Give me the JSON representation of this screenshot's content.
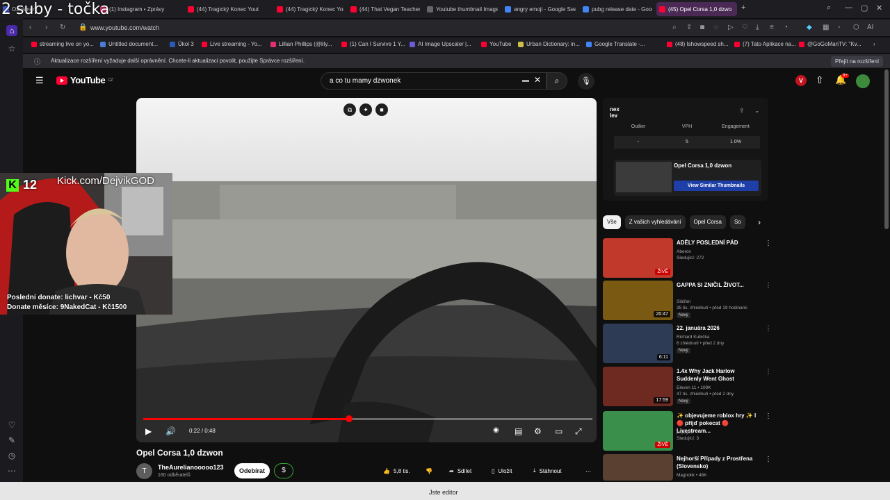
{
  "overlay_title": "2 suby - točka",
  "browser": {
    "tabs": [
      {
        "label": "Oznámení",
        "color": "#3b5bdb"
      },
      {
        "label": "(1) Instagram • Zprávy",
        "color": "#e1306c"
      },
      {
        "label": "(44) Tragický Konec Yout",
        "color": "#ff0033"
      },
      {
        "label": "(44) Tragický Konec Yout",
        "color": "#ff0033"
      },
      {
        "label": "(44) That Vegan Teacher I",
        "color": "#ff0033"
      },
      {
        "label": "Youtube thumbnail Image",
        "color": "#666666"
      },
      {
        "label": "angry emoji - Google Sea",
        "color": "#4285f4"
      },
      {
        "label": "pubg release date - Goog",
        "color": "#4285f4"
      },
      {
        "label": "(45) Opel Corsa 1,0 dzwo",
        "color": "#ff0033"
      }
    ],
    "url": "www.youtube.com/watch",
    "bookmarks": [
      {
        "label": "streaming live on yo...",
        "color": "#ff0033"
      },
      {
        "label": "Untitled document...",
        "color": "#4a7bd6"
      },
      {
        "label": "Úkol 3",
        "color": "#2a5ab8"
      },
      {
        "label": "Live streaming - Yo...",
        "color": "#ff0033"
      },
      {
        "label": "Lillian Phillips (@lily...",
        "color": "#e1306c"
      },
      {
        "label": "(1) Can I Survive 1 Y...",
        "color": "#ff0033"
      },
      {
        "label": "AI Image Upscaler |...",
        "color": "#6b5bd6"
      },
      {
        "label": "YouTube",
        "color": "#ff0033"
      },
      {
        "label": "Urban Dictionary: in...",
        "color": "#ccc04a"
      },
      {
        "label": "Google Translate -...",
        "color": "#4285f4"
      },
      {
        "label": "(48) Ishowspeed sh...",
        "color": "#ff0033"
      },
      {
        "label": "(7) Tato Aplikace na...",
        "color": "#ff0033"
      },
      {
        "label": "@GoGoManTV: \"Kv...",
        "color": "#ff0033"
      }
    ],
    "notice": "Aktualizace rozšíření vyžaduje další oprávnění. Chcete-li aktualizaci povolit, použijte Správce rozšíření.",
    "notice_button": "Přejít na rozšíření",
    "status_text": "Jste editor"
  },
  "youtube": {
    "logo": "YouTube",
    "region": "CZ",
    "search_value": "a co tu mamy dzwonek",
    "notif_count": "9+",
    "video": {
      "title": "Opel Corsa 1,0 dzwon",
      "time": "0:22 / 0:48",
      "progress": 0.4583,
      "channel": "TheAurelianooooo123",
      "avatar_letter": "T",
      "subscribers": "160 odběratelů",
      "subscribe_label": "Odebírat",
      "likes": "5,8 tis.",
      "share": "Sdílet",
      "save": "Uložit",
      "download": "Stáhnout"
    },
    "nexlev": {
      "cols": [
        "Outlier",
        "VPH",
        "Engagement"
      ],
      "vals": [
        "-",
        "5",
        "1.0%"
      ],
      "card_title": "Opel Corsa 1,0 dzwon",
      "card_button": "View Similar Thumbnails"
    },
    "chips": [
      "Vše",
      "Z vašich vyhledávání",
      "Opel Corsa",
      "So"
    ],
    "recommendations": [
      {
        "title": "ADĚLY POSLEDNÍ PÁD",
        "channel": "Aberon",
        "meta": "Sledující: 272",
        "badge": "",
        "duration": "ŽIVĚ",
        "thumb": "#c0392b"
      },
      {
        "title": "GAPPA SI ZNIČIL ŽIVOT...",
        "channel": "Sibiřan",
        "meta": "35 tis. zhlédnutí • před 19 hodinami",
        "badge": "Nový",
        "duration": "20:47",
        "thumb": "#7a5a12"
      },
      {
        "title": "22. januára 2026",
        "channel": "Richard Kubička",
        "meta": "6 zhlédnutí • před 2 dny",
        "badge": "Nový",
        "duration": "6:11",
        "thumb": "#2d3b55"
      },
      {
        "title": "1.4x Why Jack Harlow Suddenly Went Ghost",
        "channel": "Eleven 11 • 109K",
        "meta": "47 tis. zhlédnutí • před 2 dny",
        "badge": "Nový",
        "duration": "17:59",
        "thumb": "#6e2a20"
      },
      {
        "title": "✨ objevujeme roblox hry ✨ I 🔴 přijď pokecat 🔴 Livestream...",
        "channel": "pepajzik",
        "meta": "Sledující: 3",
        "badge": "",
        "duration": "ŽIVĚ",
        "thumb": "#3a8f4a"
      },
      {
        "title": "Nejhorší Případy z Prostřena (Slovensko)",
        "channel": "Magnolik • 48K",
        "meta": "",
        "badge": "",
        "duration": "",
        "thumb": "#5a4030"
      }
    ]
  },
  "stream": {
    "kick_count": "12",
    "kick_channel": "Kick.com/DejvikGOD",
    "last_donate": "Poslední donate: lichvar - Kč50",
    "month_donate": "Donate měsíce: 9NakedCat - Kč1500"
  }
}
